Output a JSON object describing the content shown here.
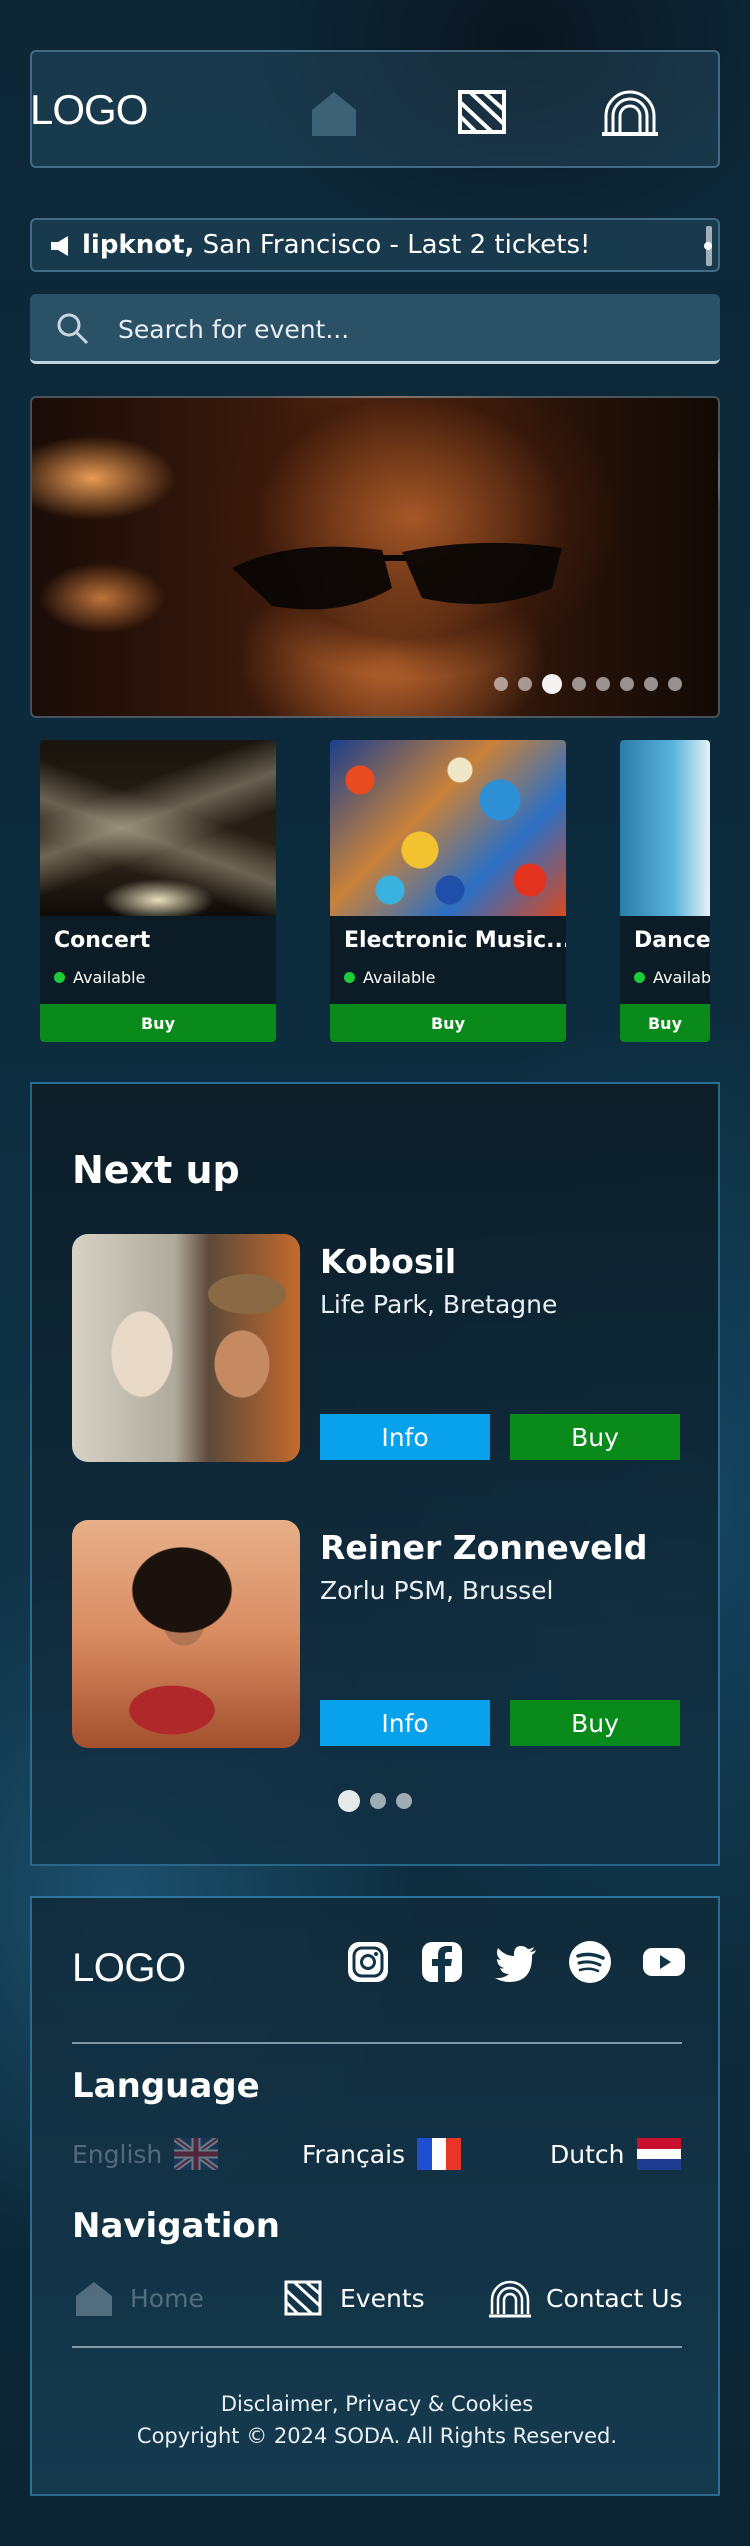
{
  "header": {
    "logo": "LOGO",
    "icons": [
      "home-icon",
      "events-icon",
      "contact-icon"
    ]
  },
  "ticker": {
    "icon": "megaphone-icon",
    "artist": "lipknot,",
    "text": "San Francisco - Last 2 tickets!"
  },
  "search": {
    "placeholder": "Search for event..."
  },
  "hero": {
    "slide_count": 8,
    "active_slide": 3
  },
  "categories": [
    {
      "title": "Concert",
      "status": "Available",
      "button": "Buy"
    },
    {
      "title": "Electronic Music...",
      "status": "Available",
      "button": "Buy"
    },
    {
      "title": "Dance",
      "status": "Available",
      "button": "Buy"
    }
  ],
  "next_up": {
    "heading": "Next up",
    "events": [
      {
        "name": "Kobosil",
        "venue": "Life Park, Bretagne",
        "info": "Info",
        "buy": "Buy"
      },
      {
        "name": "Reiner Zonneveld",
        "venue": "Zorlu PSM, Brussel",
        "info": "Info",
        "buy": "Buy"
      }
    ],
    "page_count": 3,
    "active_page": 1
  },
  "footer": {
    "logo": "LOGO",
    "socials": [
      "instagram-icon",
      "facebook-icon",
      "twitter-icon",
      "spotify-icon",
      "youtube-icon"
    ],
    "language_heading": "Language",
    "languages": [
      {
        "label": "English",
        "active": true
      },
      {
        "label": "Français",
        "active": false
      },
      {
        "label": "Dutch",
        "active": false
      }
    ],
    "navigation_heading": "Navigation",
    "nav": [
      {
        "label": "Home",
        "active": true
      },
      {
        "label": "Events",
        "active": false
      },
      {
        "label": "Contact Us",
        "active": false
      }
    ],
    "legal": "Disclaimer, Privacy & Cookies",
    "copyright": "Copyright © 2024 SODA. All Rights Reserved."
  },
  "colors": {
    "buy_green": "#0a8a1b",
    "info_blue": "#08a2ec",
    "available_dot": "#1ecb3a"
  }
}
